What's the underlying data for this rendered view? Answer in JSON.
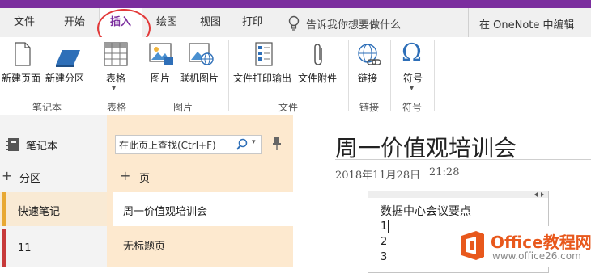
{
  "tabs": [
    {
      "label": "文件"
    },
    {
      "label": "开始"
    },
    {
      "label": "插入"
    },
    {
      "label": "绘图"
    },
    {
      "label": "视图"
    },
    {
      "label": "打印"
    }
  ],
  "tell_me": "告诉我你想要做什么",
  "edit_in_onenote": "在 OneNote 中编辑",
  "ribbon": {
    "new_page": "新建页面",
    "new_section": "新建分区",
    "table": "表格",
    "picture": "图片",
    "online_picture": "联机图片",
    "file_printout": "文件打印输出",
    "file_attachment": "文件附件",
    "link": "链接",
    "symbol": "符号",
    "dropdown_arrow": "▾",
    "symbol_glyph": "Ω",
    "groups": {
      "notebook": "笔记本",
      "tables": "表格",
      "pictures": "图片",
      "files": "文件",
      "links": "链接",
      "symbols": "符号"
    }
  },
  "notebook_panel": {
    "title": "笔记本",
    "add_section": "分区",
    "sections": [
      {
        "label": "快速笔记",
        "color": "#e8a832"
      },
      {
        "label": "11",
        "color": "#c73a3a"
      }
    ]
  },
  "pages_panel": {
    "search_placeholder": "在此页上查找(Ctrl+F)",
    "add_page": "页",
    "pages": [
      {
        "label": "周一价值观培训会"
      },
      {
        "label": "无标题页"
      }
    ]
  },
  "page": {
    "title": "周一价值观培训会",
    "date": "2018年11月28日",
    "time": "21:28",
    "note_lines": [
      "数据中心会议要点",
      "1",
      "2",
      "3"
    ]
  },
  "watermark": {
    "brand": "Office教程网",
    "url": "www.office26.com"
  },
  "colors": {
    "accent": "#7b2e9e",
    "annotation_red": "#e33a3a",
    "pages_bg": "#fde9cf"
  }
}
